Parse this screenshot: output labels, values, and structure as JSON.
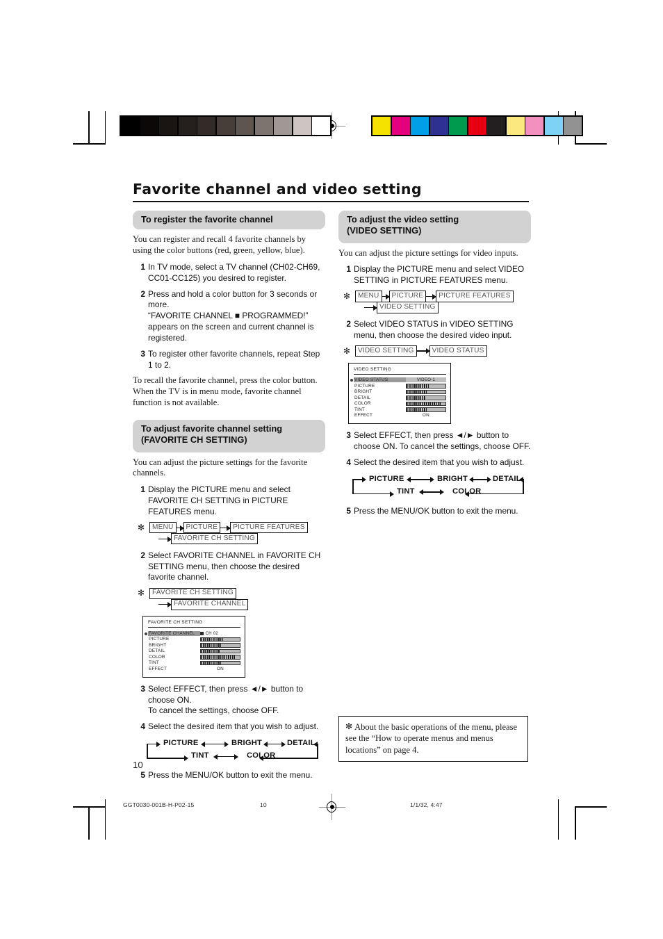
{
  "document": {
    "headline": "Favorite channel and video setting",
    "page_number": "10"
  },
  "footer": {
    "doc_code": "GGT0030-001B-H-P02-15",
    "page": "10",
    "timestamp": "1/1/32, 4:47"
  },
  "color_bars": {
    "grayscale": [
      "#000000",
      "#0c0807",
      "#1a1412",
      "#25201d",
      "#332b28",
      "#473e3a",
      "#5f554f",
      "#7d7470",
      "#a09894",
      "#cec5c2",
      "#ffffff"
    ],
    "chroma": [
      "#f5e200",
      "#e5007e",
      "#00a0e9",
      "#2e3192",
      "#009a4e",
      "#e60012",
      "#231f20",
      "#fbe87f",
      "#f390c0",
      "#7ed2f5",
      "#929292"
    ]
  },
  "left_column": {
    "section1": {
      "header": "To register the favorite channel",
      "intro": "You can register and recall 4 favorite channels by using the color buttons (red, green, yellow, blue).",
      "steps": [
        {
          "num": "1",
          "text": "In TV mode, select a TV channel (CH02-CH69, CC01-CC125) you desired to register."
        },
        {
          "num": "2",
          "text": "Press and hold a color button for 3 seconds or more.\n“FAVORITE CHANNEL ■ PROGRAMMED!”\nappears on the screen and current channel is registered."
        },
        {
          "num": "3",
          "text": "To register other favorite channels, repeat Step 1 to 2."
        }
      ],
      "outro": "To recall the favorite channel, press the color button.\nWhen the TV is in menu mode, favorite channel function is not available."
    },
    "section2": {
      "header_line1": "To adjust favorite channel setting",
      "header_line2": "(FAVORITE CH SETTING)",
      "intro": "You can adjust the picture settings for the favorite channels.",
      "step1": {
        "num": "1",
        "text": "Display the PICTURE menu and select FAVORITE CH SETTING in PICTURE FEATURES menu."
      },
      "path1": {
        "aster": "✻",
        "row1": [
          "MENU",
          "PICTURE",
          "PICTURE FEATURES"
        ],
        "row2": [
          "FAVORITE CH SETTING"
        ]
      },
      "step2": {
        "num": "2",
        "text": "Select FAVORITE CHANNEL in FAVORITE CH SETTING menu, then choose the desired favorite channel."
      },
      "path2": {
        "aster": "✻",
        "row1": [
          "FAVORITE CH SETTING"
        ],
        "row2": [
          "FAVORITE CHANNEL"
        ]
      },
      "osd": {
        "title": "FAVORITE CH SETTING",
        "rows": [
          {
            "label": "FAVORITE CHANNEL",
            "selected": true,
            "value_kind": "channel",
            "value": "CH 02"
          },
          {
            "label": "PICTURE",
            "selected": false,
            "value_kind": "gauge",
            "fill": 58
          },
          {
            "label": "BRIGHT",
            "selected": false,
            "value_kind": "gauge",
            "fill": 52
          },
          {
            "label": "DETAIL",
            "selected": false,
            "value_kind": "gauge",
            "fill": 50
          },
          {
            "label": "COLOR",
            "selected": false,
            "value_kind": "gauge",
            "fill": 88
          },
          {
            "label": "TINT",
            "selected": false,
            "value_kind": "gauge",
            "fill": 52
          },
          {
            "label": "EFFECT",
            "selected": false,
            "value_kind": "text",
            "value": "ON"
          }
        ]
      },
      "step3": {
        "num": "3",
        "text": "Select EFFECT, then press ◄/► button to choose ON.\nTo cancel the settings, choose OFF."
      },
      "step4": {
        "num": "4",
        "text": "Select the desired item that you wish to adjust."
      },
      "cycle": {
        "top": [
          "PICTURE",
          "BRIGHT",
          "DETAIL"
        ],
        "bottom": [
          "TINT",
          "COLOR"
        ]
      },
      "step5": {
        "num": "5",
        "text": "Press the MENU/OK button to exit the menu."
      }
    }
  },
  "right_column": {
    "section": {
      "header_line1": "To adjust the video setting",
      "header_line2": "(VIDEO SETTING)",
      "intro": "You can adjust the picture settings for video inputs.",
      "step1": {
        "num": "1",
        "text": "Display the PICTURE menu and select VIDEO SETTING in PICTURE FEATURES menu."
      },
      "path1": {
        "aster": "✻",
        "row1": [
          "MENU",
          "PICTURE",
          "PICTURE FEATURES"
        ],
        "row2": [
          "VIDEO SETTING"
        ]
      },
      "step2": {
        "num": "2",
        "text": "Select VIDEO STATUS in VIDEO SETTING menu, then choose the desired video input."
      },
      "path2": {
        "aster": "✻",
        "row1": [
          "VIDEO SETTING",
          "VIDEO STATUS"
        ]
      },
      "osd": {
        "title": "VIDEO SETTING",
        "rows": [
          {
            "label": "VIDEO STATUS",
            "selected": true,
            "value_kind": "badge",
            "value": "VIDEO-1"
          },
          {
            "label": "PICTURE",
            "selected": false,
            "value_kind": "gauge",
            "fill": 58
          },
          {
            "label": "BRIGHT",
            "selected": false,
            "value_kind": "gauge",
            "fill": 52
          },
          {
            "label": "DETAIL",
            "selected": false,
            "value_kind": "gauge",
            "fill": 50
          },
          {
            "label": "COLOR",
            "selected": false,
            "value_kind": "gauge",
            "fill": 88
          },
          {
            "label": "TINT",
            "selected": false,
            "value_kind": "gauge",
            "fill": 52
          },
          {
            "label": "EFFECT",
            "selected": false,
            "value_kind": "text",
            "value": "ON"
          }
        ]
      },
      "step3": {
        "num": "3",
        "text": "Select EFFECT, then press ◄/► button to choose ON. To cancel the settings, choose OFF."
      },
      "step4": {
        "num": "4",
        "text": "Select the desired item that you wish to adjust."
      },
      "cycle": {
        "top": [
          "PICTURE",
          "BRIGHT",
          "DETAIL"
        ],
        "bottom": [
          "TINT",
          "COLOR"
        ]
      },
      "step5": {
        "num": "5",
        "text": "Press the MENU/OK button to exit the menu."
      }
    },
    "note": {
      "aster": "✻",
      "text": "About the basic operations of the menu, please see the “How to operate menus and menus locations” on page 4."
    }
  }
}
